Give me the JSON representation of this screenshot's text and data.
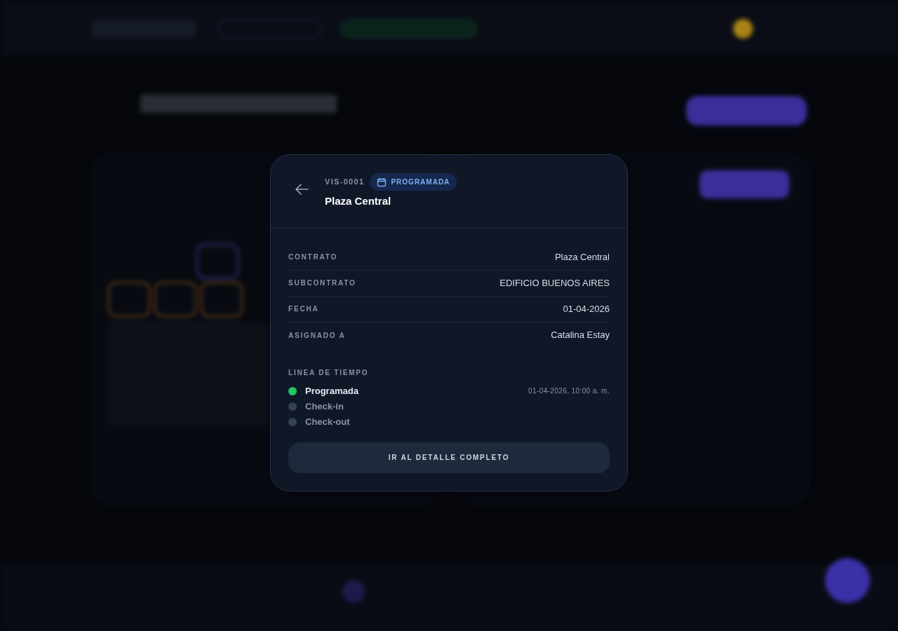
{
  "modal": {
    "code": "VIS-0001",
    "status": {
      "label": "PROGRAMADA"
    },
    "title": "Plaza Central",
    "details": [
      {
        "label": "CONTRATO",
        "value": "Plaza Central"
      },
      {
        "label": "SUBCONTRATO",
        "value": "EDIFICIO BUENOS AIRES"
      },
      {
        "label": "FECHA",
        "value": "01-04-2026"
      },
      {
        "label": "ASIGNADO A",
        "value": "Catalina Estay"
      }
    ],
    "timeline": {
      "title": "LINEA DE TIEMPO",
      "items": [
        {
          "label": "Programada",
          "done": true,
          "time": "01-04-2026, 10:00 a. m."
        },
        {
          "label": "Check-in",
          "done": false
        },
        {
          "label": "Check-out",
          "done": false
        }
      ]
    },
    "button": "IR AL DETALLE COMPLETO"
  }
}
